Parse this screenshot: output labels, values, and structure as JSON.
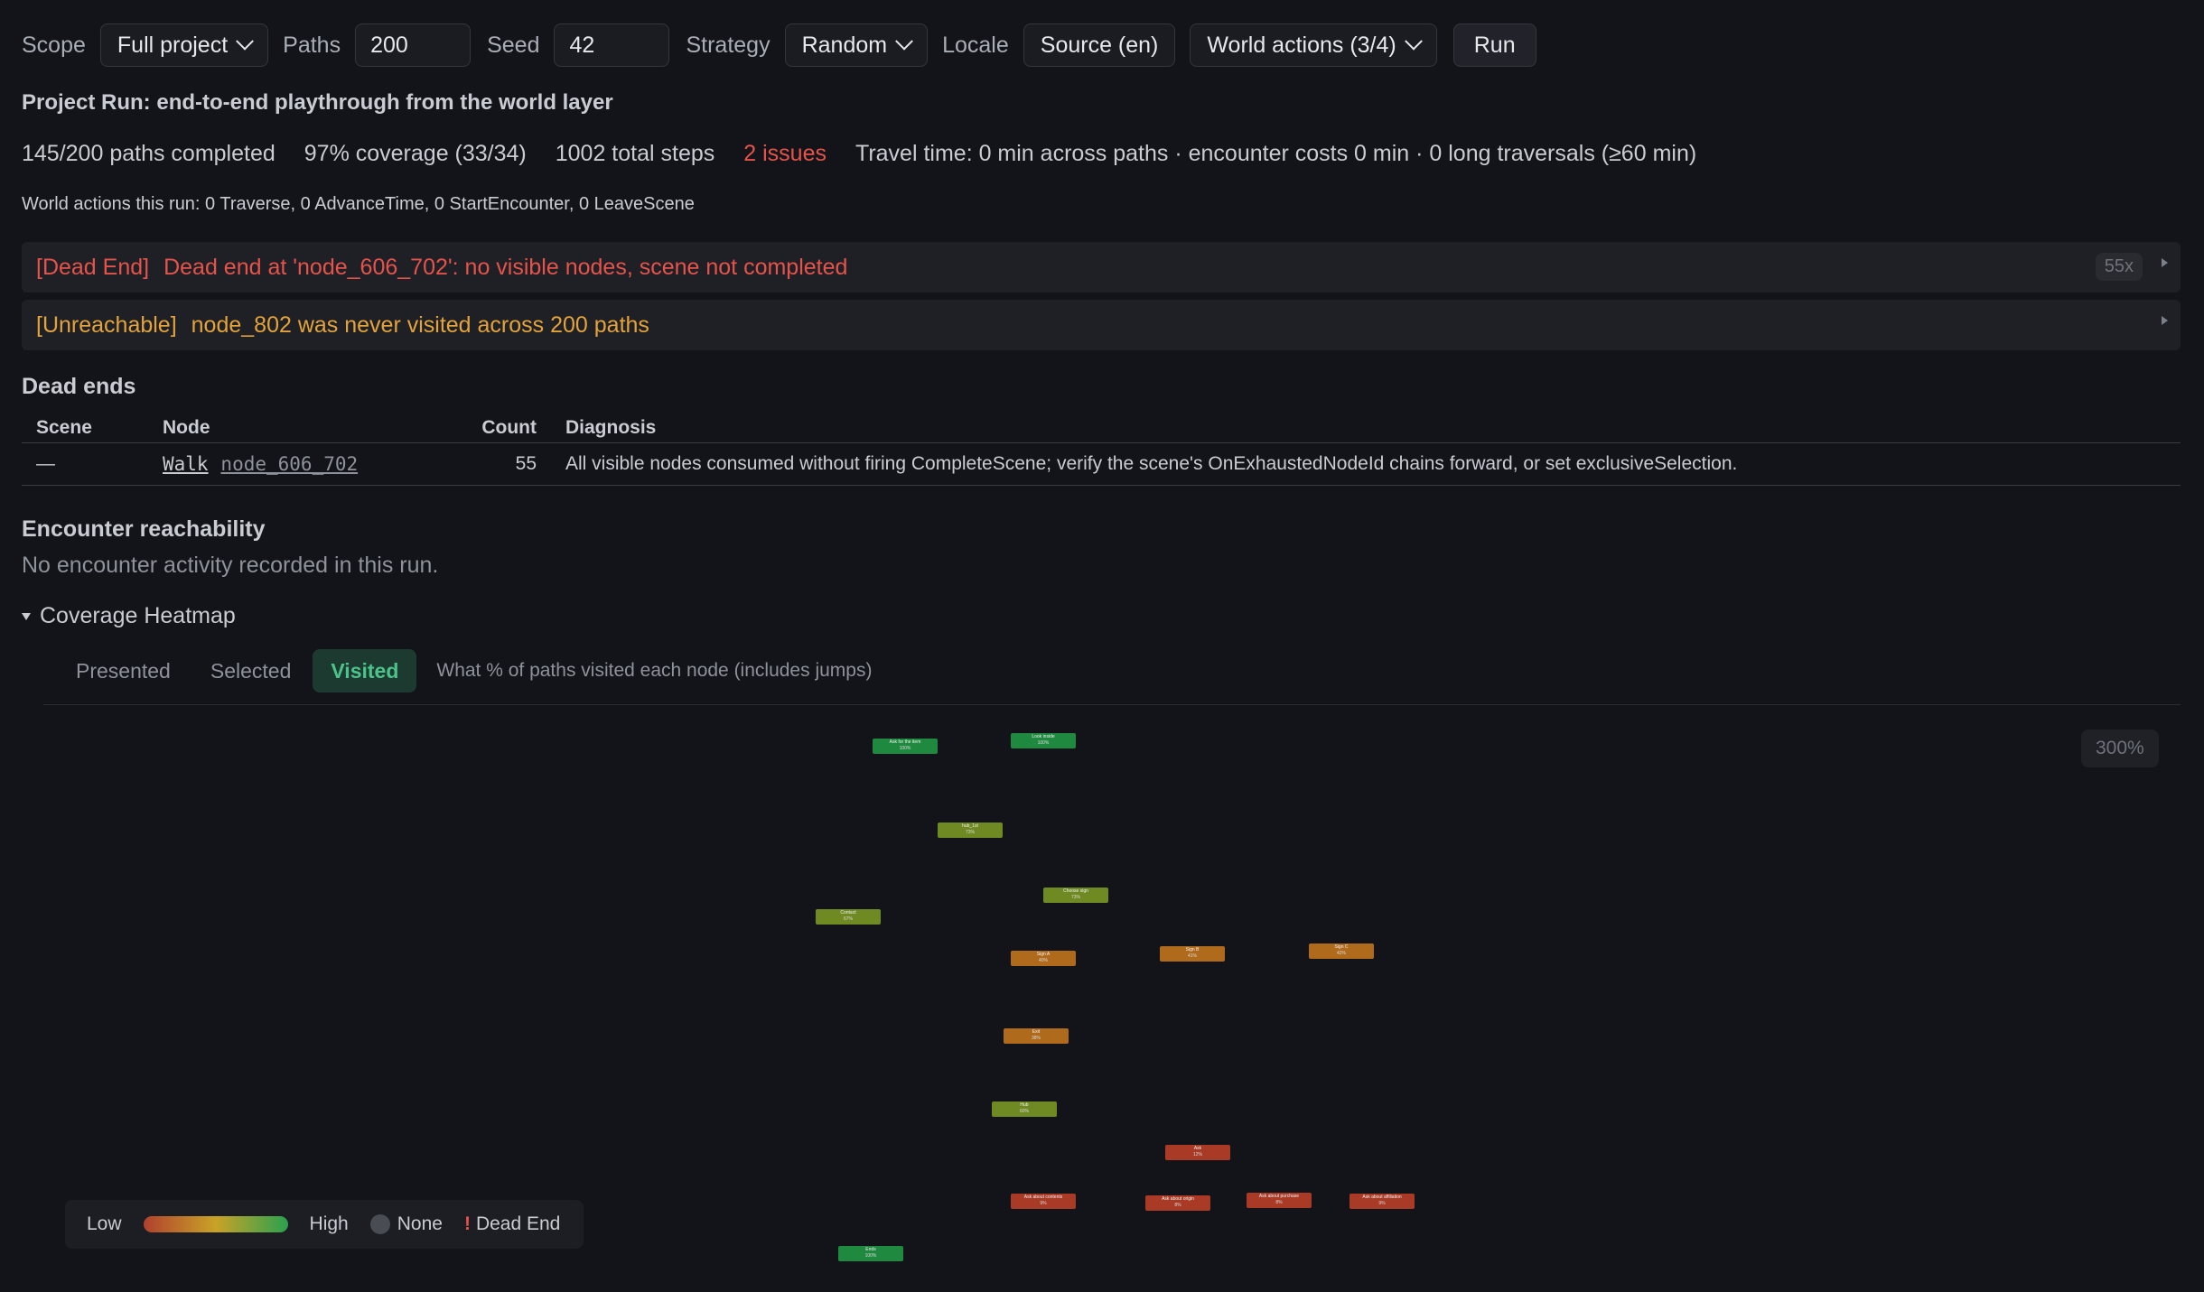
{
  "toolbar": {
    "scope_label": "Scope",
    "scope_value": "Full project",
    "paths_label": "Paths",
    "paths_value": "200",
    "seed_label": "Seed",
    "seed_value": "42",
    "strategy_label": "Strategy",
    "strategy_value": "Random",
    "locale_label": "Locale",
    "locale_value": "Source (en)",
    "world_actions_value": "World actions (3/4)",
    "run_label": "Run"
  },
  "title": "Project Run: end-to-end playthrough from the world layer",
  "stats": {
    "paths": "145/200 paths completed",
    "coverage": "97% coverage (33/34)",
    "steps": "1002 total steps",
    "issues": "2 issues",
    "travel": "Travel time: 0 min across paths · encounter costs 0 min · 0 long traversals (≥60 min)"
  },
  "world_actions": "World actions this run: 0 Traverse, 0 AdvanceTime, 0 StartEncounter, 0 LeaveScene",
  "issues": [
    {
      "tag": "[Dead End]",
      "message": "Dead end at 'node_606_702': no visible nodes, scene not completed",
      "count": "55x"
    },
    {
      "tag": "[Unreachable]",
      "message": "node_802 was never visited across 200 paths"
    }
  ],
  "dead_ends": {
    "heading": "Dead ends",
    "columns": [
      "Scene",
      "Node",
      "Count",
      "Diagnosis"
    ],
    "rows": [
      {
        "scene": "—",
        "walk": "Walk",
        "node": "node_606_702",
        "count": "55",
        "diagnosis": "All visible nodes consumed without firing CompleteScene; verify the scene's OnExhaustedNodeId chains forward, or set exclusiveSelection."
      }
    ]
  },
  "encounter": {
    "heading": "Encounter reachability",
    "message": "No encounter activity recorded in this run."
  },
  "heatmap": {
    "heading": "Coverage Heatmap",
    "tabs": [
      "Presented",
      "Selected",
      "Visited"
    ],
    "active_tab": "Visited",
    "description": "What % of paths visited each node (includes jumps)",
    "zoom": "300%",
    "nodes": [
      {
        "label": "Ask for the item",
        "pct": "100%",
        "color": "#1f8a3f"
      },
      {
        "label": "Look inside",
        "pct": "100%",
        "color": "#1f8a3f"
      },
      {
        "label": "hub_1st",
        "pct": "73%",
        "color": "#6f8a22"
      },
      {
        "label": "Choose sign",
        "pct": "73%",
        "color": "#6f8a22"
      },
      {
        "label": "Contact",
        "pct": "67%",
        "color": "#6f8a22"
      },
      {
        "label": "Sign A",
        "pct": "40%",
        "color": "#b06a1c"
      },
      {
        "label": "Sign B",
        "pct": "41%",
        "color": "#b06a1c"
      },
      {
        "label": "Sign C",
        "pct": "42%",
        "color": "#b06a1c"
      },
      {
        "label": "Exit",
        "pct": "38%",
        "color": "#b06a1c"
      },
      {
        "label": "Hub",
        "pct": "60%",
        "color": "#6f8a22"
      },
      {
        "label": "Ask",
        "pct": "12%",
        "color": "#a83a26"
      },
      {
        "label": "Ask about contents",
        "pct": "9%",
        "color": "#a83a26"
      },
      {
        "label": "Ask about origin",
        "pct": "8%",
        "color": "#a83a26"
      },
      {
        "label": "Ask about purchase",
        "pct": "8%",
        "color": "#a83a26"
      },
      {
        "label": "Ask about affiliation",
        "pct": "9%",
        "color": "#a83a26"
      },
      {
        "label": "Ends",
        "pct": "100%",
        "color": "#1f8a3f"
      }
    ],
    "legend": {
      "low": "Low",
      "high": "High",
      "none": "None",
      "dead_end": "Dead End",
      "bang": "!"
    }
  }
}
